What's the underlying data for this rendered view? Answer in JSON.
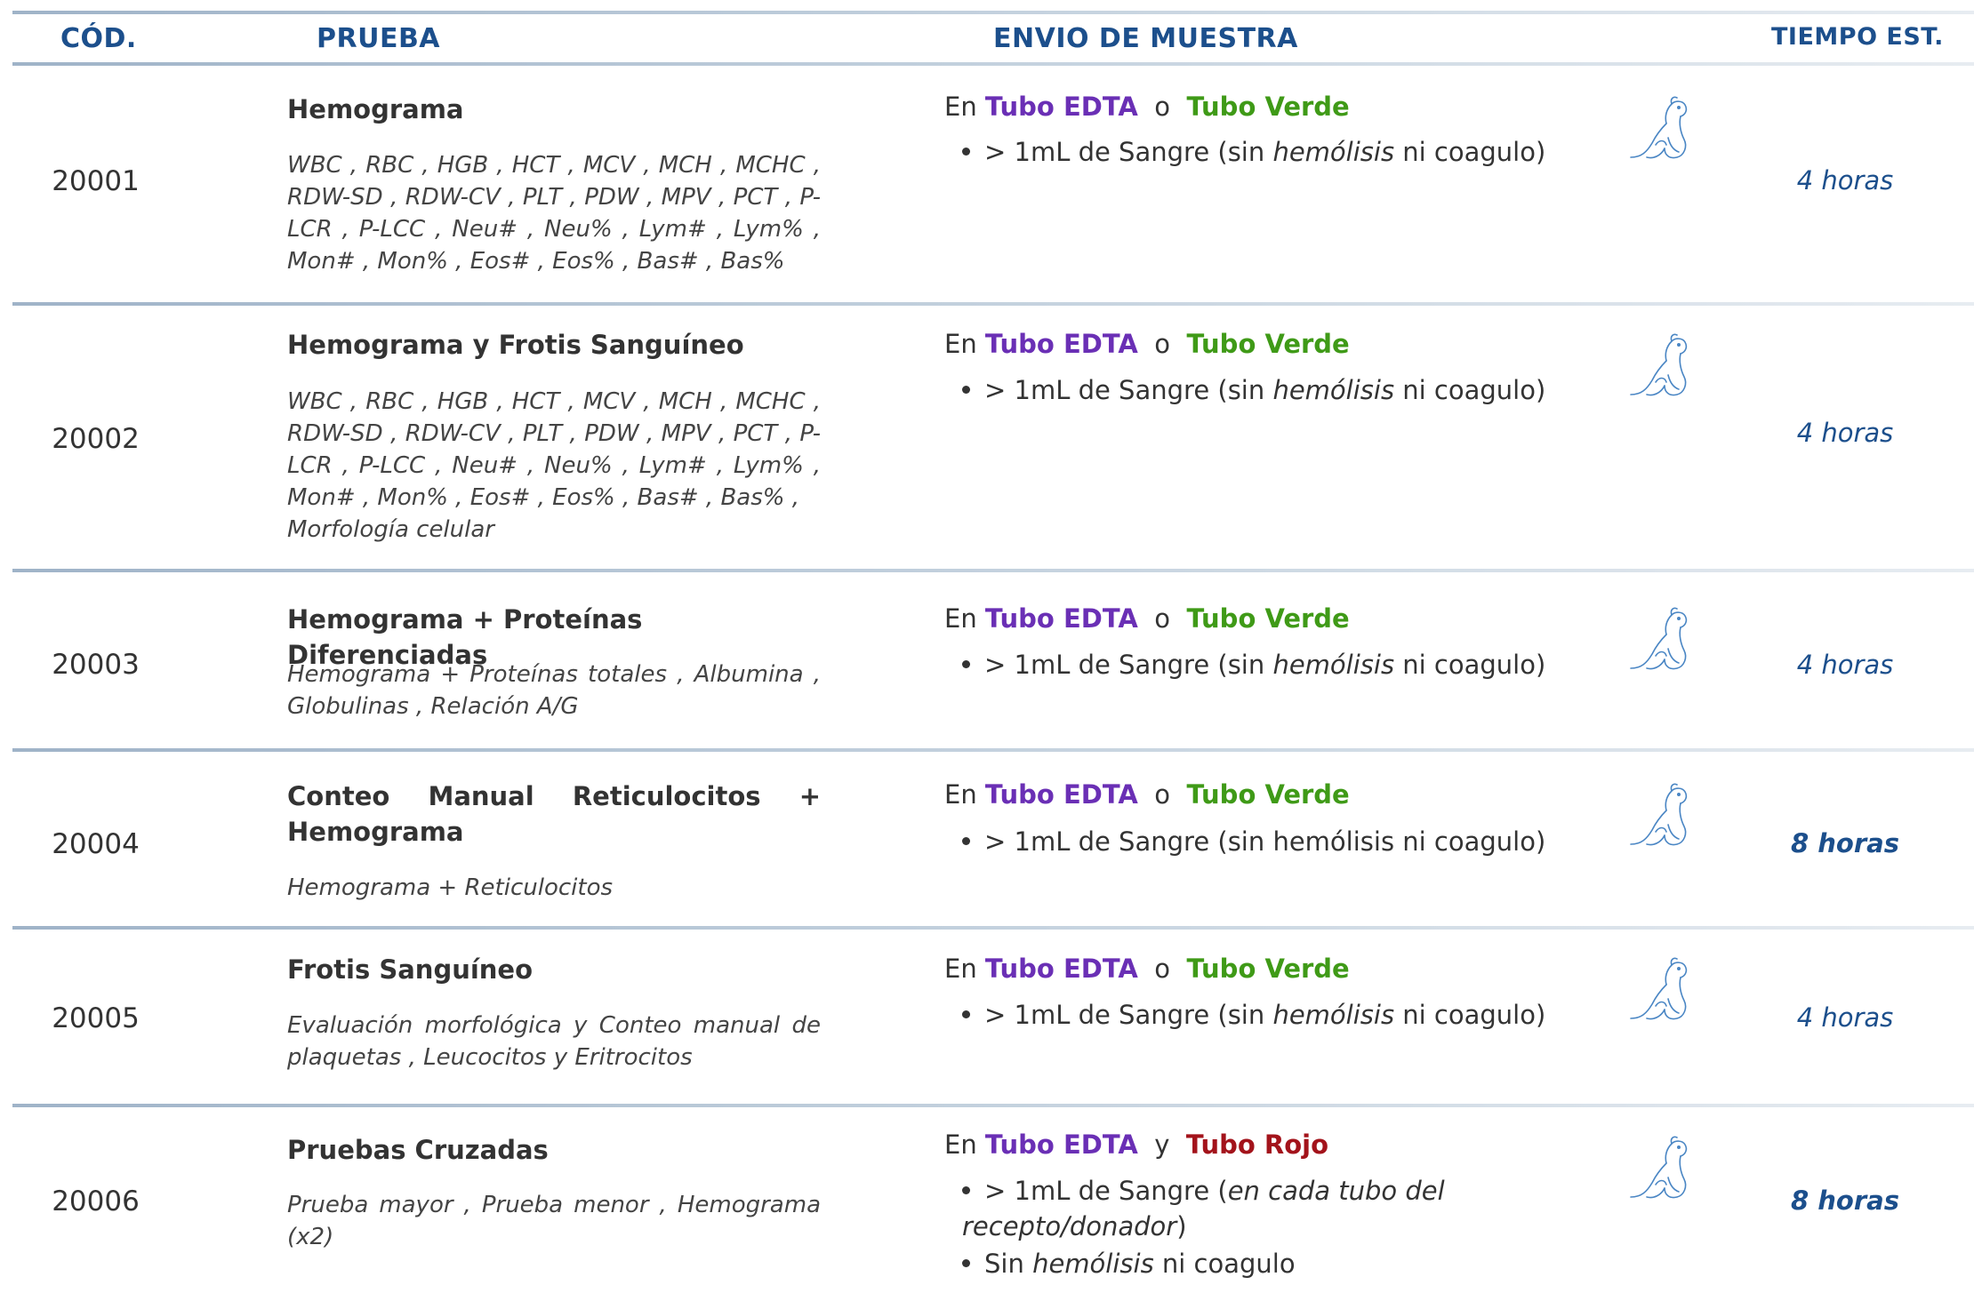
{
  "header": {
    "code": "CÓD.",
    "test": "PRUEBA",
    "shipping": "ENVIO DE MUESTRA",
    "time": "TIEMPO EST."
  },
  "common": {
    "en": "En",
    "o": "o",
    "y": "y",
    "tubo_edta": "Tubo EDTA",
    "tubo_verde": "Tubo Verde",
    "tubo_rojo": "Tubo Rojo",
    "sample_prefix": "> 1mL de Sangre (sin ",
    "hemolisis": "hemólisis",
    "sample_suffix": " ni coagulo)",
    "sample_plain": "> 1mL de Sangre (sin hemólisis ni coagulo)"
  },
  "rows": [
    {
      "code": "20001",
      "title": "Hemograma",
      "desc": "WBC , RBC , HGB , HCT , MCV , MCH , MCHC , RDW-SD , RDW-CV , PLT , PDW , MPV , PCT , P-LCR , P-LCC , Neu# , Neu% , Lym# , Lym% , Mon# , Mon% , Eos# , Eos% , Bas# , Bas%",
      "time": "4 horas"
    },
    {
      "code": "20002",
      "title": "Hemograma y Frotis Sanguíneo",
      "desc": "WBC , RBC , HGB , HCT , MCV , MCH , MCHC , RDW-SD , RDW-CV , PLT , PDW , MPV , PCT , P-LCR , P-LCC , Neu# , Neu% , Lym# , Lym% , Mon# , Mon% , Eos# , Eos% , Bas# , Bas% ,",
      "desc_last": "Morfología celular",
      "time": "4 horas"
    },
    {
      "code": "20003",
      "title": "Hemograma + Proteínas Diferenciadas",
      "desc": "Hemograma + Proteínas totales , Albumina , Globulinas , Relación A/G",
      "time": "4 horas"
    },
    {
      "code": "20004",
      "title_line1": "Conteo Manual Reticulocitos +",
      "title_line2": "Hemograma",
      "desc": "Hemograma + Reticulocitos",
      "time": "8 horas"
    },
    {
      "code": "20005",
      "title": "Frotis Sanguíneo",
      "desc": "Evaluación morfológica y Conteo manual de plaquetas , Leucocitos y Eritrocitos",
      "time": "4 horas"
    },
    {
      "code": "20006",
      "title": "Pruebas Cruzadas",
      "desc": "Prueba mayor , Prueba menor , Hemograma (x2)",
      "sample_a": "> 1mL de Sangre (",
      "sample_a_italic": "en cada tubo del recepto/donador",
      "sample_a_end": ")",
      "sample_b_prefix": "Sin ",
      "sample_b_suffix": " ni coagulo",
      "time": "8 horas"
    }
  ],
  "colors": {
    "header_blue": "#1c4f8c",
    "edta_purple": "#6a2fb5",
    "verde_green": "#3f9a17",
    "rojo_red": "#a3131b"
  },
  "icons": {
    "pet": "dog-and-cat-outline-icon"
  }
}
